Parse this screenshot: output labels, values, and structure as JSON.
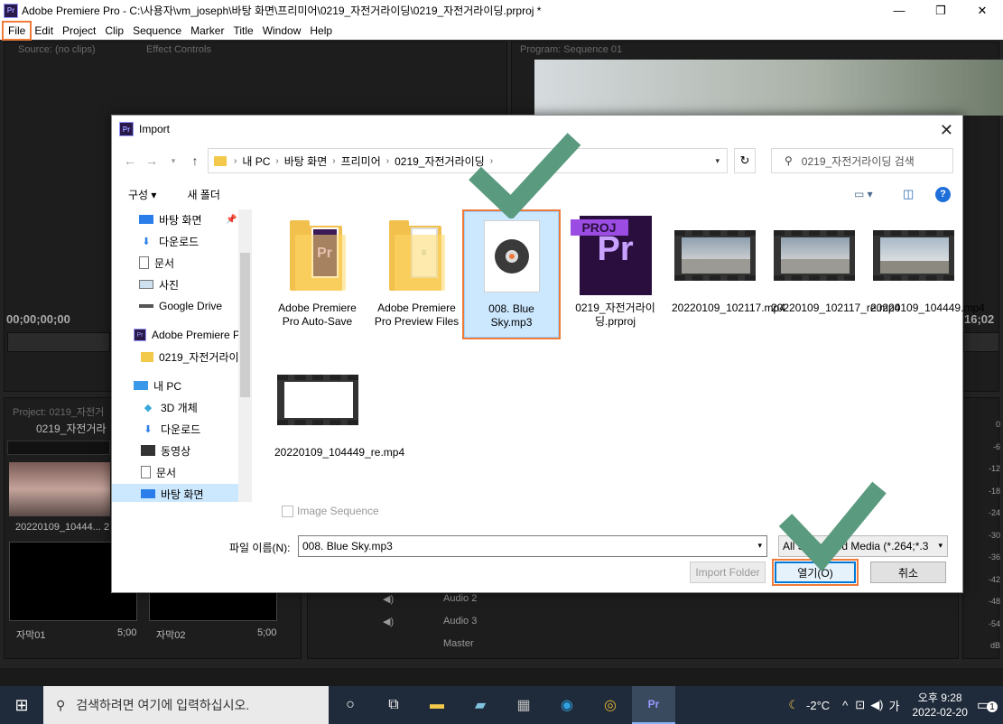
{
  "window": {
    "title": "Adobe Premiere Pro - C:\\사용자\\vm_joseph\\바탕 화면\\프리미어\\0219_자전거라이딩\\0219_자전거라이딩.prproj *",
    "icon": "Pr"
  },
  "menu": [
    "File",
    "Edit",
    "Project",
    "Clip",
    "Sequence",
    "Marker",
    "Title",
    "Window",
    "Help"
  ],
  "premiere": {
    "source_tab": "Source: (no clips)",
    "effect_controls_tab": "Effect Controls",
    "program_tab": "Program: Sequence 01",
    "timecode_left": "00;00;00;00",
    "timecode_right": "16;02",
    "project_tab": "Project: 0219_자전거",
    "project_name": "0219_자전거라",
    "bin_items": [
      {
        "name": "20220109_10444...",
        "duration": "2"
      },
      {
        "name": "자막01",
        "duration": "5;00"
      },
      {
        "name": "자막02",
        "duration": "5;00"
      }
    ],
    "tracks": [
      "Audio 2",
      "Audio 3",
      "Master"
    ],
    "meter_labels": [
      "0",
      "-6",
      "-12",
      "-18",
      "-24",
      "-30",
      "-36",
      "-42",
      "-48",
      "-54",
      "dB"
    ]
  },
  "dialog": {
    "icon": "Pr",
    "title": "Import",
    "breadcrumbs": [
      "내 PC",
      "바탕 화면",
      "프리미어",
      "0219_자전거라이딩"
    ],
    "search_placeholder": "0219_자전거라이딩 검색",
    "commands": {
      "organize": "구성 ▾",
      "new_folder": "새 폴더"
    },
    "nav": [
      {
        "label": "바탕 화면",
        "icon": "desktop-icon",
        "pinned": true
      },
      {
        "label": "다운로드",
        "icon": "download-icon",
        "pinned": true
      },
      {
        "label": "문서",
        "icon": "document-icon",
        "pinned": true
      },
      {
        "label": "사진",
        "icon": "picture-icon",
        "pinned": true
      },
      {
        "label": "Google Drive",
        "icon": "drive-icon",
        "pinned": true
      },
      {
        "label": "Adobe Premiere P",
        "icon": "premiere-icon",
        "pinned": false
      },
      {
        "label": "0219_자전거라이",
        "icon": "folder-icon",
        "pinned": false
      },
      {
        "label": "내 PC",
        "icon": "pc-icon",
        "pinned": false
      },
      {
        "label": "3D 개체",
        "icon": "3d-icon",
        "pinned": false
      },
      {
        "label": "다운로드",
        "icon": "download-icon",
        "pinned": false
      },
      {
        "label": "동영상",
        "icon": "video-icon",
        "pinned": false
      },
      {
        "label": "문서",
        "icon": "document-icon",
        "pinned": false
      },
      {
        "label": "바탕 화면",
        "icon": "desktop-icon",
        "pinned": false
      }
    ],
    "files": [
      {
        "name": "Adobe Premiere Pro Auto-Save",
        "kind": "folder-pr"
      },
      {
        "name": "Adobe Premiere Pro Preview Files",
        "kind": "folder-doc"
      },
      {
        "name": "008. Blue Sky.mp3",
        "kind": "mp3",
        "selected": true
      },
      {
        "name": "0219_자전거라이딩.prproj",
        "kind": "proj"
      },
      {
        "name": "20220109_102117.mp4",
        "kind": "video"
      },
      {
        "name": "20220109_102117_re.mp4",
        "kind": "video"
      },
      {
        "name": "20220109_104449.mp4",
        "kind": "video"
      },
      {
        "name": "20220109_104449_re.mp4",
        "kind": "video-white"
      }
    ],
    "image_sequence_label": "Image Sequence",
    "filename_label": "파일 이름(N):",
    "filename_value": "008. Blue Sky.mp3",
    "filter_value": "All Supported Media (*.264;*.3",
    "buttons": {
      "import_folder": "Import Folder",
      "open": "열기(O)",
      "cancel": "취소"
    }
  },
  "taskbar": {
    "search_placeholder": "검색하려면 여기에 입력하십시오.",
    "weather": "-2°C",
    "ime": "가",
    "time": "오후 9:28",
    "date": "2022-02-20",
    "notifications": "1"
  },
  "colors": {
    "accent_orange": "#f07a3a",
    "check_green": "#5a9a7e",
    "selection": "#cce8ff"
  }
}
